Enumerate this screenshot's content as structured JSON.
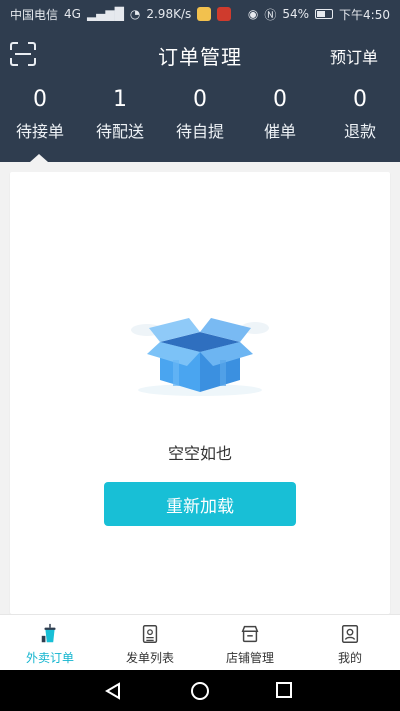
{
  "status_bar": {
    "carrier": "中国电信",
    "network": "4G",
    "speed": "2.98K/s",
    "battery": "54%",
    "time": "下午4:50"
  },
  "header": {
    "title": "订单管理",
    "right_action": "预订单",
    "stats": [
      {
        "value": "0",
        "label": "待接单"
      },
      {
        "value": "1",
        "label": "待配送"
      },
      {
        "value": "0",
        "label": "待自提"
      },
      {
        "value": "0",
        "label": "催单"
      },
      {
        "value": "0",
        "label": "退款"
      }
    ]
  },
  "empty_state": {
    "message": "空空如也",
    "reload_label": "重新加载"
  },
  "tabbar": {
    "tabs": [
      {
        "label": "外卖订单",
        "icon": "drink-cup-icon",
        "active": true
      },
      {
        "label": "发单列表",
        "icon": "document-list-icon",
        "active": false
      },
      {
        "label": "店铺管理",
        "icon": "store-icon",
        "active": false
      },
      {
        "label": "我的",
        "icon": "profile-icon",
        "active": false
      }
    ]
  },
  "colors": {
    "header_bg": "#2f3d4f",
    "accent": "#18bfd6",
    "active_tab": "#13b5cf"
  }
}
